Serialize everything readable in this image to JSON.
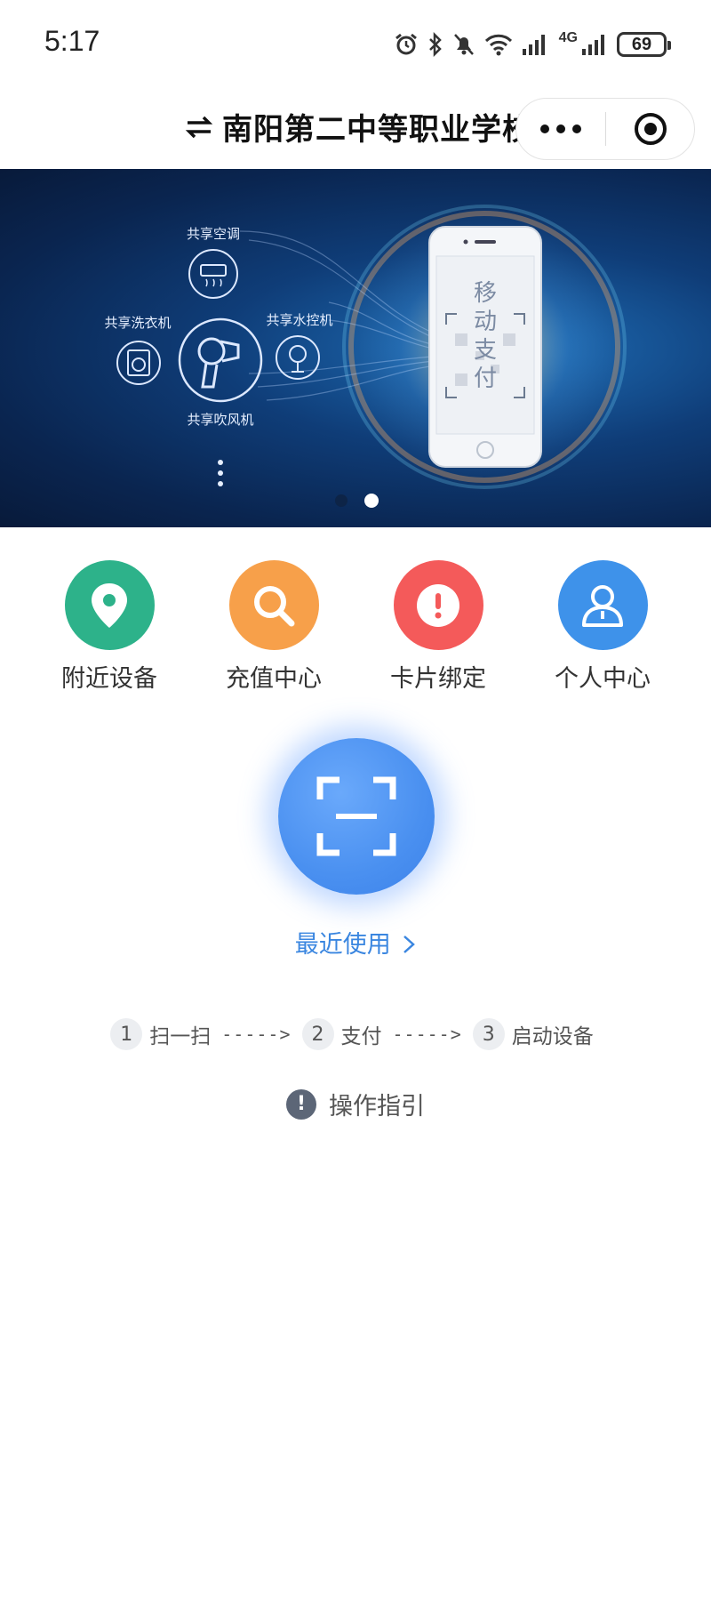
{
  "status_bar": {
    "time": "5:17",
    "network": "4G",
    "battery": "69"
  },
  "nav": {
    "title": "南阳第二中等职业学校",
    "more_icon": "more-icon",
    "close_icon": "close-icon"
  },
  "banner": {
    "labels": {
      "ac": "共享空调",
      "washer": "共享洗衣机",
      "water": "共享水控机",
      "dryer": "共享吹风机"
    },
    "phone_text": [
      "移",
      "动",
      "支",
      "付"
    ],
    "page_count": 2,
    "active_page": 2
  },
  "menu": [
    {
      "label": "附近设备",
      "icon": "location-icon",
      "color": "#2db28a"
    },
    {
      "label": "充值中心",
      "icon": "search-icon",
      "color": "#f7a04a"
    },
    {
      "label": "卡片绑定",
      "icon": "alert-icon",
      "color": "#f45a5a"
    },
    {
      "label": "个人中心",
      "icon": "user-icon",
      "color": "#3e92ea"
    }
  ],
  "scan": {
    "icon": "scan-icon",
    "recent": "最近使用"
  },
  "steps": [
    {
      "num": "1",
      "text": "扫一扫"
    },
    {
      "num": "2",
      "text": "支付"
    },
    {
      "num": "3",
      "text": "启动设备"
    }
  ],
  "arrow": "----->",
  "guide": {
    "text": "操作指引",
    "icon": "!"
  }
}
